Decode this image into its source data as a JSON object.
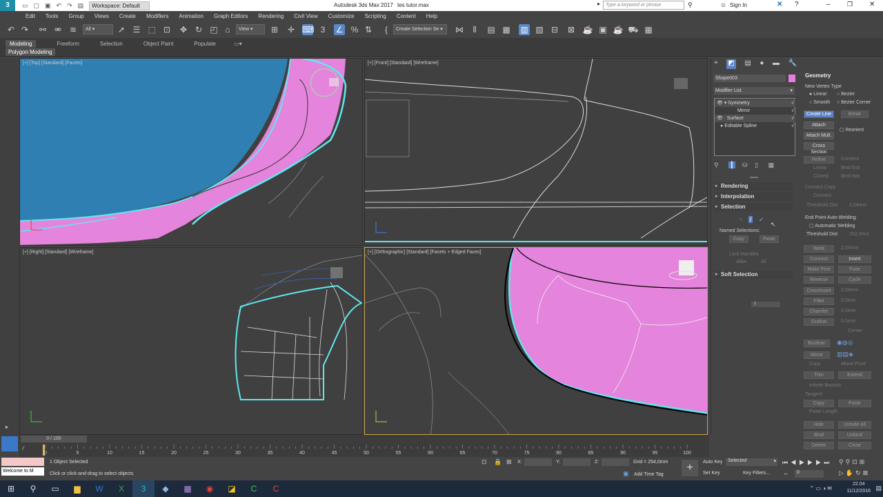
{
  "titlebar": {
    "workspace": "Workspace: Default",
    "app_title": "Autodesk 3ds Max 2017",
    "file_name": "tes tutor.max",
    "search_placeholder": "Type a keyword or phrase",
    "sign_in": "Sign In"
  },
  "menu": [
    "Edit",
    "Tools",
    "Group",
    "Views",
    "Create",
    "Modifiers",
    "Animation",
    "Graph Editors",
    "Rendering",
    "Civil View",
    "Customize",
    "Scripting",
    "Content",
    "Help"
  ],
  "toolbar": {
    "filter_value": "All",
    "view_value": "View",
    "selection_set": "Create Selection Se"
  },
  "ribbon": {
    "tabs": [
      "Modeling",
      "Freeform",
      "Selection",
      "Object Paint",
      "Populate"
    ],
    "subtab": "Polygon Modeling"
  },
  "viewports": {
    "top": "[+] [Top] [Standard] [Facets]",
    "front": "[+] [Front] [Standard] [Wireframe]",
    "right": "[+] [Right] [Standard] [Wireframe]",
    "ortho": "[+] [Orthographic] [Standard] [Facets + Edged Faces]"
  },
  "command_panel": {
    "object_name": "Shape003",
    "object_color": "#e87de0",
    "modifier_list": "Modifier List",
    "stack": [
      "Symmetry",
      "Mirror",
      "Surface",
      "Editable Spline"
    ],
    "rollouts": [
      "Rendering",
      "Interpolation",
      "Selection",
      "Soft Selection"
    ],
    "named_selections": "Named Selections:",
    "copy": "Copy",
    "paste": "Paste",
    "lock_handles": "Lock Handles",
    "alike": "Alike",
    "all": "All",
    "spinner_value": "1"
  },
  "geometry": {
    "title": "Geometry",
    "new_vertex_type": "New Vertex Type",
    "linear": "Linear",
    "bezier": "Bezier",
    "smooth": "Smooth",
    "bezier_corner": "Bezier Corner",
    "create_line": "Create Line",
    "break": "Break",
    "attach": "Attach",
    "reorient": "Reorient",
    "attach_mult": "Attach Mult.",
    "cross_section": "Cross Section",
    "refine": "Refine",
    "connect": "Connect",
    "linear2": "Linear",
    "bind_first": "Bind first",
    "closed": "Closed",
    "bind_last": "Bind last",
    "connect_copy": "Connect Copy",
    "connect2": "Connect",
    "threshold_dist": "Threshold Dist",
    "threshold_val1": "2,54mm",
    "end_point_welding": "End Point Auto-Welding",
    "automatic_welding": "Automatic Welding",
    "threshold_val2": "152,4mm",
    "weld": "Weld",
    "weld_val": "2,54mm",
    "connect3": "Connect",
    "insert": "Insert",
    "make_first": "Make First",
    "fuse": "Fuse",
    "reverse": "Reverse",
    "cycle": "Cycle",
    "crossinsert": "CrossInsert",
    "crossinsert_val": "2,54mm",
    "fillet": "Fillet",
    "fillet_val": "0,0mm",
    "chamfer": "Chamfer",
    "chamfer_val": "0,0mm",
    "outline": "Outline",
    "outline_val": "0,0mm",
    "center": "Center",
    "boolean": "Boolean",
    "mirror": "Mirror",
    "copy": "Copy",
    "about_pivot": "About Pivot",
    "trim": "Trim",
    "extend": "Extend",
    "infinite_bounds": "Infinite Bounds",
    "tangent": "Tangent",
    "copy2": "Copy",
    "paste": "Paste",
    "paste_length": "Paste Length",
    "hide": "Hide",
    "unhide_all": "Unhide All",
    "bind": "Bind",
    "unbind": "Unbind",
    "delete": "Delete",
    "close": "Close"
  },
  "timeline": {
    "frame": "0 / 100",
    "ticks": [
      "0",
      "5",
      "10",
      "15",
      "20",
      "25",
      "30",
      "35",
      "40",
      "45",
      "50",
      "55",
      "60",
      "65",
      "70",
      "75",
      "80",
      "85",
      "90",
      "95",
      "100"
    ]
  },
  "status": {
    "welcome": "Welcome to M",
    "selected": "1 Object Selected",
    "hint": "Click or click-and-drag to select objects",
    "x_label": "X:",
    "y_label": "Y:",
    "z_label": "Z:",
    "grid": "Grid = 254,0mm",
    "add_time_tag": "Add Time Tag",
    "auto_key": "Auto Key",
    "selected_dropdown": "Selected",
    "set_key": "Set Key",
    "key_filters": "Key Filters...",
    "frame_value": "0"
  },
  "taskbar": {
    "time": "22.04",
    "date": "11/12/2016"
  },
  "colors": {
    "pink": "#e583dc",
    "blue": "#2f7fb3",
    "cyan": "#5fe8ef",
    "active_border": "#cfa44b"
  }
}
